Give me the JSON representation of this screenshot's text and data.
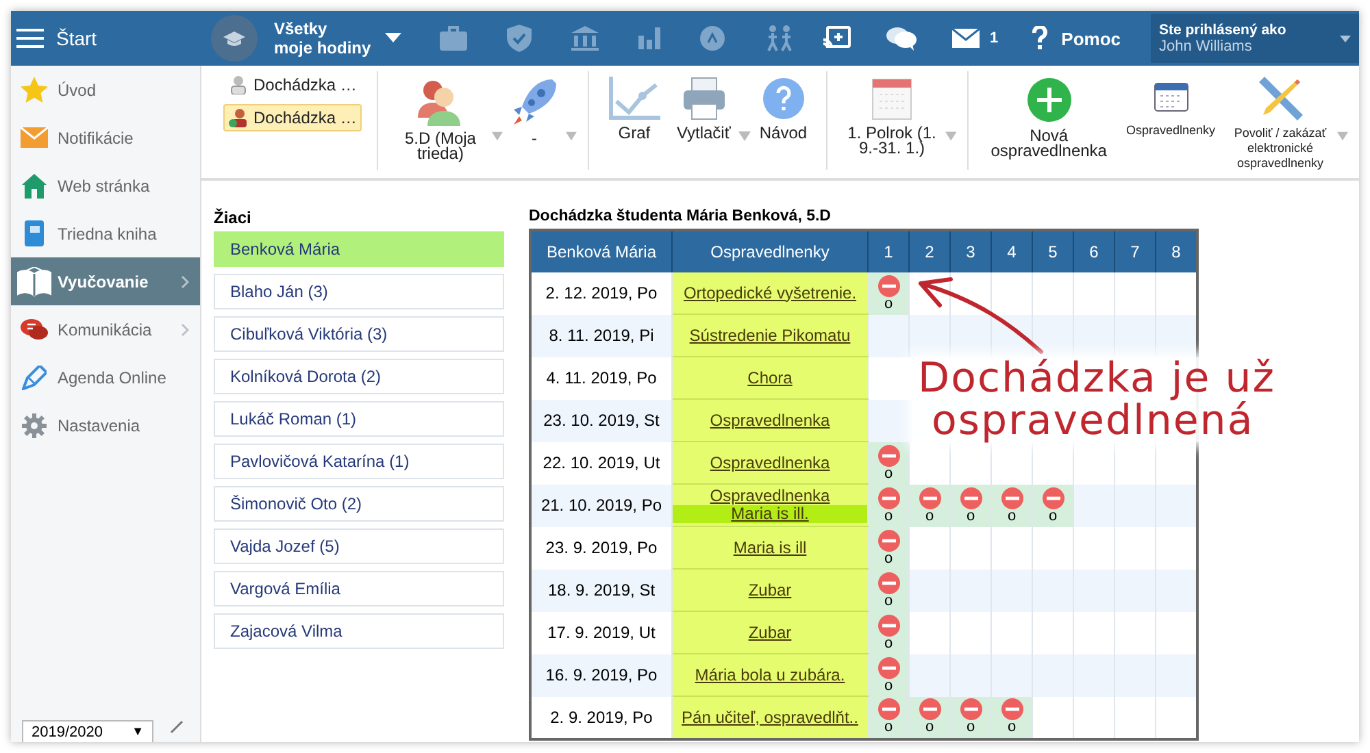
{
  "topbar": {
    "menu_label": "Štart",
    "hours": {
      "line1": "Všetky",
      "line2": "moje hodiny"
    },
    "mail_count": "1",
    "help": "Pomoc",
    "user": {
      "caption": "Ste prihlásený ako",
      "name": "John Williams"
    }
  },
  "sidebar": {
    "items": [
      {
        "label": "Úvod",
        "selected": false,
        "has_submenu": false
      },
      {
        "label": "Notifikácie",
        "selected": false,
        "has_submenu": false
      },
      {
        "label": "Web stránka",
        "selected": false,
        "has_submenu": false
      },
      {
        "label": "Triedna kniha",
        "selected": false,
        "has_submenu": false
      },
      {
        "label": "Vyučovanie",
        "selected": true,
        "has_submenu": true
      },
      {
        "label": "Komunikácia",
        "selected": false,
        "has_submenu": true
      },
      {
        "label": "Agenda Online",
        "selected": false,
        "has_submenu": false
      },
      {
        "label": "Nastavenia",
        "selected": false,
        "has_submenu": false
      }
    ],
    "year": "2019/2020",
    "year_caret": "▼"
  },
  "toolbar": {
    "views": [
      {
        "label": "Dochádzka …",
        "selected": false
      },
      {
        "label": "Dochádzka …",
        "selected": true
      }
    ],
    "class_select": "5.D (Moja trieda)",
    "subject_select": "-",
    "graph": "Graf",
    "print": "Vytlačiť",
    "help": "Návod",
    "period": "1. Polrok (1. 9.-31. 1.)",
    "new_excuse": "Nová ospravedlnenka",
    "excuses": "Ospravedlnenky",
    "toggle_excuses": "Povoliť / zakázať elektronické ospravedlnenky"
  },
  "students": {
    "title": "Žiaci",
    "items": [
      {
        "label": "Benková Mária",
        "selected": true
      },
      {
        "label": "Blaho Ján (3)",
        "selected": false
      },
      {
        "label": "Cibuľková Viktória (3)",
        "selected": false
      },
      {
        "label": "Kolníková Dorota (2)",
        "selected": false
      },
      {
        "label": "Lukáč Roman (1)",
        "selected": false
      },
      {
        "label": "Pavlovičová Katarína (1)",
        "selected": false
      },
      {
        "label": "Šimonovič Oto (2)",
        "selected": false
      },
      {
        "label": "Vajda Jozef (5)",
        "selected": false
      },
      {
        "label": "Vargová Emília",
        "selected": false
      },
      {
        "label": "Zajacová Vilma",
        "selected": false
      }
    ]
  },
  "attendance": {
    "title": "Dochádzka študenta Mária Benková, 5.D",
    "columns": [
      "Benková Mária",
      "Ospravedlnenky",
      "1",
      "2",
      "3",
      "4",
      "5",
      "6",
      "7",
      "8"
    ],
    "rows": [
      {
        "date": "2. 12. 2019, Po",
        "excuses": [
          {
            "text": "Ortopedické vyšetrenie.",
            "highlighted": false
          }
        ],
        "lessons": [
          {
            "absent": true,
            "mark": "o"
          },
          {
            "absent": false
          },
          {
            "absent": false
          },
          {
            "absent": false
          },
          {
            "absent": false
          },
          {
            "absent": false
          },
          {
            "absent": false
          },
          {
            "absent": false
          }
        ]
      },
      {
        "date": "8. 11. 2019, Pi",
        "excuses": [
          {
            "text": "Sústredenie Pikomatu",
            "highlighted": false
          }
        ],
        "lessons": [
          {
            "absent": false
          },
          {
            "absent": false
          },
          {
            "absent": false
          },
          {
            "absent": false
          },
          {
            "absent": false
          },
          {
            "absent": false
          },
          {
            "absent": false
          },
          {
            "absent": false
          }
        ]
      },
      {
        "date": "4. 11. 2019, Po",
        "excuses": [
          {
            "text": "Chora",
            "highlighted": false
          }
        ],
        "lessons": [
          {
            "absent": false
          }
        ]
      },
      {
        "date": "23. 10. 2019, St",
        "excuses": [
          {
            "text": "Ospravedlnenka",
            "highlighted": false
          }
        ],
        "lessons": [
          {
            "absent": false
          }
        ]
      },
      {
        "date": "22. 10. 2019, Ut",
        "excuses": [
          {
            "text": "Ospravedlnenka",
            "highlighted": false
          }
        ],
        "lessons": [
          {
            "absent": true,
            "mark": "o"
          },
          {
            "absent": false
          },
          {
            "absent": false
          },
          {
            "absent": false
          },
          {
            "absent": false
          },
          {
            "absent": false
          },
          {
            "absent": false
          },
          {
            "absent": false
          }
        ]
      },
      {
        "date": "21. 10. 2019, Po",
        "excuses": [
          {
            "text": "Ospravedlnenka",
            "highlighted": false
          },
          {
            "text": "Maria is ill.",
            "highlighted": true
          }
        ],
        "lessons": [
          {
            "absent": true,
            "mark": "o"
          },
          {
            "absent": true,
            "mark": "o"
          },
          {
            "absent": true,
            "mark": "o"
          },
          {
            "absent": true,
            "mark": "o"
          },
          {
            "absent": true,
            "mark": "o"
          },
          {
            "absent": false
          },
          {
            "absent": false
          },
          {
            "absent": false
          }
        ]
      },
      {
        "date": "23. 9. 2019, Po",
        "excuses": [
          {
            "text": "Maria is ill",
            "highlighted": false
          }
        ],
        "lessons": [
          {
            "absent": true,
            "mark": "o"
          },
          {
            "absent": false
          },
          {
            "absent": false
          },
          {
            "absent": false
          },
          {
            "absent": false
          },
          {
            "absent": false
          },
          {
            "absent": false
          },
          {
            "absent": false
          }
        ]
      },
      {
        "date": "18. 9. 2019, St",
        "excuses": [
          {
            "text": "Zubar",
            "highlighted": false
          }
        ],
        "lessons": [
          {
            "absent": true,
            "mark": "o"
          },
          {
            "absent": false
          },
          {
            "absent": false
          },
          {
            "absent": false
          },
          {
            "absent": false
          },
          {
            "absent": false
          },
          {
            "absent": false
          },
          {
            "absent": false
          }
        ]
      },
      {
        "date": "17. 9. 2019, Ut",
        "excuses": [
          {
            "text": "Zubar",
            "highlighted": false
          }
        ],
        "lessons": [
          {
            "absent": true,
            "mark": "o"
          },
          {
            "absent": false
          },
          {
            "absent": false
          },
          {
            "absent": false
          },
          {
            "absent": false
          },
          {
            "absent": false
          },
          {
            "absent": false
          },
          {
            "absent": false
          }
        ]
      },
      {
        "date": "16. 9. 2019, Po",
        "excuses": [
          {
            "text": "Mária bola u zubára.",
            "highlighted": false
          }
        ],
        "lessons": [
          {
            "absent": true,
            "mark": "o"
          },
          {
            "absent": false
          },
          {
            "absent": false
          },
          {
            "absent": false
          },
          {
            "absent": false
          },
          {
            "absent": false
          },
          {
            "absent": false
          },
          {
            "absent": false
          }
        ]
      },
      {
        "date": "2. 9. 2019, Po",
        "excuses": [
          {
            "text": "Pán učiteľ, ospravedlňt..",
            "highlighted": false
          }
        ],
        "lessons": [
          {
            "absent": true,
            "mark": "o"
          },
          {
            "absent": true,
            "mark": "o"
          },
          {
            "absent": true,
            "mark": "o"
          },
          {
            "absent": true,
            "mark": "o"
          },
          {
            "absent": false
          },
          {
            "absent": false
          },
          {
            "absent": false
          },
          {
            "absent": false
          }
        ]
      }
    ]
  },
  "annotation": {
    "lines": [
      "Dochádzka je už",
      "ospravedlnená"
    ]
  }
}
